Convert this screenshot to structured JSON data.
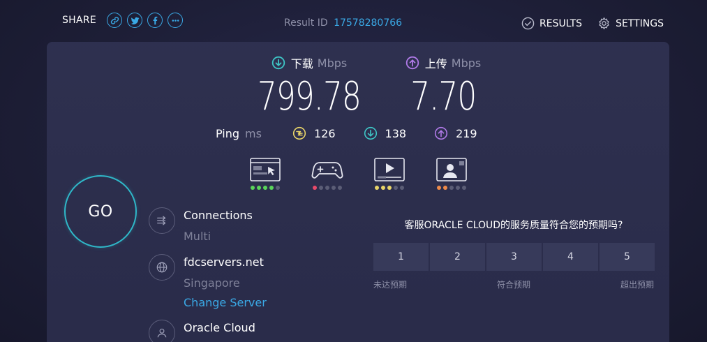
{
  "header": {
    "share_label": "SHARE",
    "result_id_label": "Result ID",
    "result_id": "17578280766",
    "results_label": "RESULTS",
    "settings_label": "SETTINGS"
  },
  "download": {
    "label": "下载",
    "unit": "Mbps",
    "value": "799.78",
    "icon": "download-arrow-icon",
    "color": "#3ec6c6"
  },
  "upload": {
    "label": "上传",
    "unit": "Mbps",
    "value": "7.70",
    "icon": "upload-arrow-icon",
    "color": "#b07ae8"
  },
  "ping": {
    "label": "Ping",
    "unit": "ms",
    "idle": "126",
    "download": "138",
    "upload": "219",
    "idle_color": "#e8d468"
  },
  "activities": [
    {
      "name": "web-browsing-icon",
      "dots": [
        "#5ad45a",
        "#5ad45a",
        "#5ad45a",
        "#5ad45a",
        "#5b5d76"
      ]
    },
    {
      "name": "gaming-icon",
      "dots": [
        "#e84a6a",
        "#5b5d76",
        "#5b5d76",
        "#5b5d76",
        "#5b5d76"
      ]
    },
    {
      "name": "video-streaming-icon",
      "dots": [
        "#e8d468",
        "#e8d468",
        "#e8d468",
        "#5b5d76",
        "#5b5d76"
      ]
    },
    {
      "name": "video-call-icon",
      "dots": [
        "#ee8a4a",
        "#ee8a4a",
        "#5b5d76",
        "#5b5d76",
        "#5b5d76"
      ]
    }
  ],
  "go_label": "GO",
  "connections": {
    "title": "Connections",
    "value": "Multi"
  },
  "server": {
    "name": "fdcservers.net",
    "location": "Singapore",
    "change_label": "Change Server"
  },
  "provider": {
    "name": "Oracle Cloud"
  },
  "survey": {
    "question": "客服ORACLE CLOUD的服务质量符合您的预期吗?",
    "options": [
      "1",
      "2",
      "3",
      "4",
      "5"
    ],
    "low_label": "未达预期",
    "mid_label": "符合预期",
    "high_label": "超出预期"
  }
}
